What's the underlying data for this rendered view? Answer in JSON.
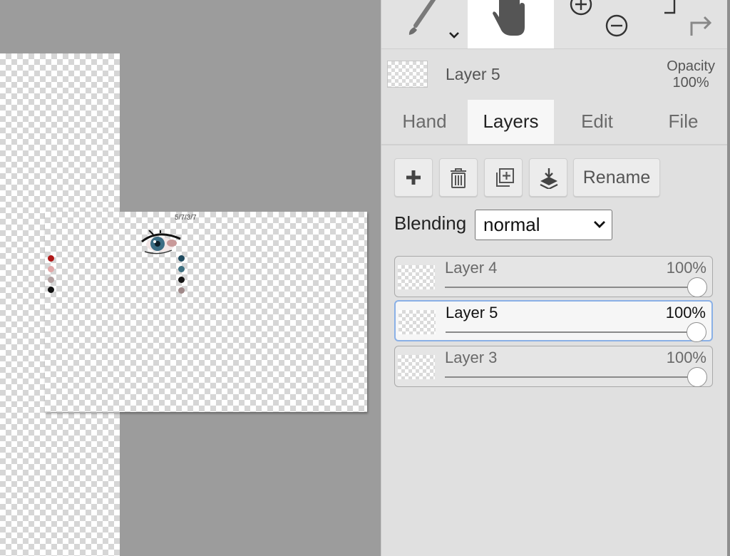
{
  "toolbar": {
    "tools": [
      {
        "name": "brush",
        "icon": "brush-icon",
        "active": false
      },
      {
        "name": "hand",
        "icon": "hand-icon",
        "active": true
      },
      {
        "name": "zoom",
        "icon": "zoom-icon",
        "active": false
      },
      {
        "name": "undo-redo",
        "icon": "undo-redo-icon",
        "active": false
      }
    ]
  },
  "current_layer": {
    "name": "Layer 5",
    "opacity_label": "Opacity",
    "opacity_value": "100%"
  },
  "tabs": [
    {
      "label": "Hand",
      "active": false
    },
    {
      "label": "Layers",
      "active": true
    },
    {
      "label": "Edit",
      "active": false
    },
    {
      "label": "File",
      "active": false
    }
  ],
  "layer_actions": {
    "add_icon": "plus-icon",
    "delete_icon": "trash-icon",
    "duplicate_icon": "duplicate-icon",
    "merge_icon": "merge-down-icon",
    "rename_label": "Rename"
  },
  "blending": {
    "label": "Blending",
    "value": "normal"
  },
  "layers": [
    {
      "name": "Layer 4",
      "opacity": "100%",
      "opacity_fraction": 1.0,
      "selected": false
    },
    {
      "name": "Layer 5",
      "opacity": "100%",
      "opacity_fraction": 1.0,
      "selected": true
    },
    {
      "name": "Layer 3",
      "opacity": "100%",
      "opacity_fraction": 1.0,
      "selected": false
    }
  ],
  "canvas": {
    "scribble_text": "5/7/3/7",
    "colors": {
      "swatch_left": [
        "#b01818",
        "#e0a8a8",
        "#b2a0a0",
        "#111111"
      ],
      "swatch_right": [
        "#1f4a5e",
        "#3d6f80",
        "#141414",
        "#a08a8a"
      ]
    }
  },
  "colors": {
    "panel_bg": "#e0e0e0",
    "workspace_bg": "#9c9c9c",
    "selection_border": "#8ab0e6"
  }
}
